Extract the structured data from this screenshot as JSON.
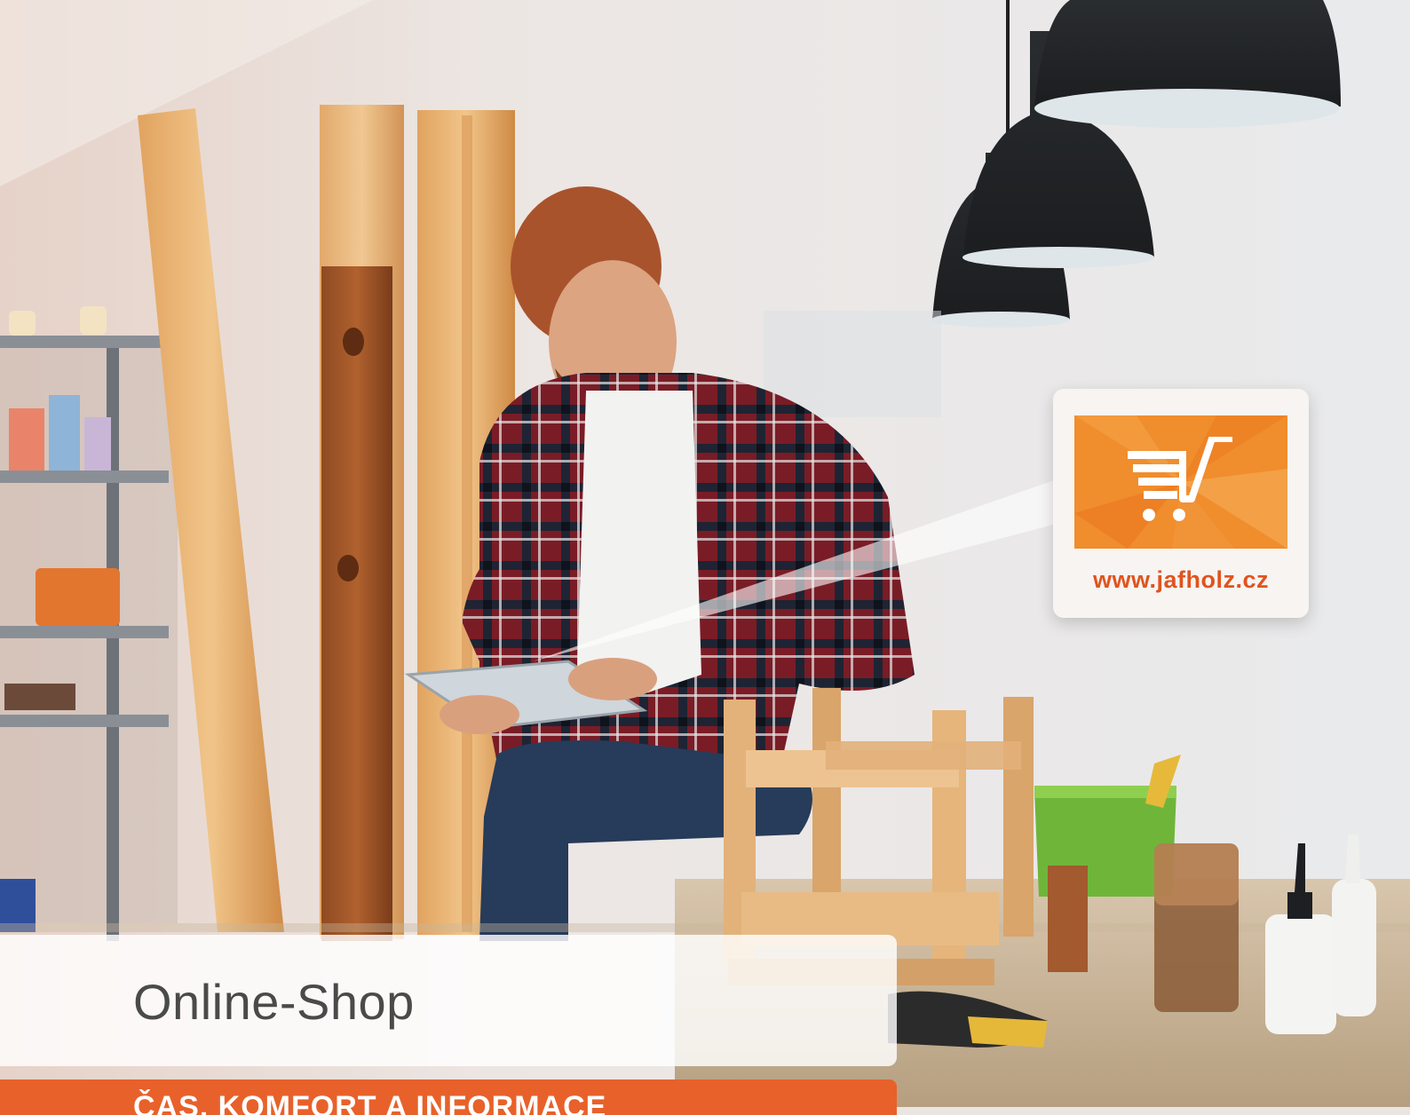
{
  "hero": {
    "title": "Online-Shop",
    "subtitle": "ČAS, KOMFORT A INFORMACE"
  },
  "shop_card": {
    "url": "www.jafholz.cz",
    "icon": "shopping-cart-icon"
  },
  "colors": {
    "accent_orange": "#e8612a",
    "tile_orange": "#f08d2c",
    "url_orange": "#e0541f",
    "title_gray": "#4a4a4a"
  }
}
